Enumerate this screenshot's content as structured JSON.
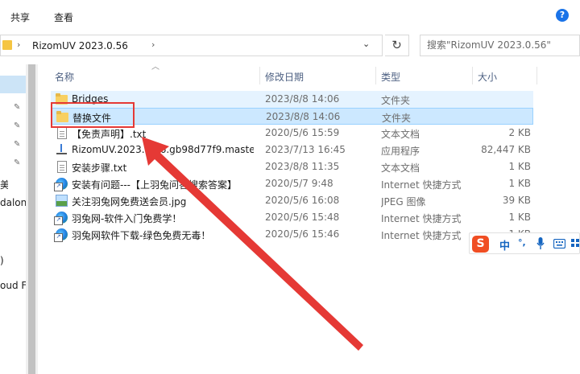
{
  "ribbon": {
    "tabs": [
      "共享",
      "查看"
    ]
  },
  "address": {
    "path": "RizomUV 2023.0.56"
  },
  "search": {
    "placeholder": "搜索\"RizomUV 2023.0.56\""
  },
  "nav": {
    "fragments": [
      "美",
      "dalon",
      ")",
      "oud F"
    ]
  },
  "columns": {
    "name": "名称",
    "date": "修改日期",
    "type": "类型",
    "size": "大小"
  },
  "files": [
    {
      "name": "Bridges",
      "date": "2023/8/8 14:06",
      "type": "文件夹",
      "size": "",
      "icon": "folder-icon"
    },
    {
      "name": "替换文件",
      "date": "2023/8/8 14:06",
      "type": "文件夹",
      "size": "",
      "icon": "folder-icon"
    },
    {
      "name": "【免责声明】.txt",
      "date": "2020/5/6 15:59",
      "type": "文本文档",
      "size": "2 KB",
      "icon": "text-file-icon"
    },
    {
      "name": "RizomUV.2023.0.56.gb98d77f9.maste...",
      "date": "2023/7/13 16:45",
      "type": "应用程序",
      "size": "82,447 KB",
      "icon": "installer-icon"
    },
    {
      "name": "安装步骤.txt",
      "date": "2023/8/8 11:35",
      "type": "文本文档",
      "size": "1 KB",
      "icon": "text-file-icon"
    },
    {
      "name": "安装有问题---【上羽兔问答搜索答案】",
      "date": "2020/5/7 9:48",
      "type": "Internet 快捷方式",
      "size": "1 KB",
      "icon": "internet-shortcut-icon"
    },
    {
      "name": "关注羽兔网免费送会员.jpg",
      "date": "2020/5/6 16:08",
      "type": "JPEG 图像",
      "size": "39 KB",
      "icon": "image-file-icon"
    },
    {
      "name": "羽兔网-软件入门免费学！",
      "date": "2020/5/6 15:48",
      "type": "Internet 快捷方式",
      "size": "1 KB",
      "icon": "internet-shortcut-icon"
    },
    {
      "name": "羽兔网软件下载-绿色免费无毒！",
      "date": "2020/5/6 15:46",
      "type": "Internet 快捷方式",
      "size": "1 KB",
      "icon": "internet-shortcut-icon"
    }
  ],
  "ime": {
    "logo": "S",
    "lang": "中",
    "punct": "°,"
  }
}
